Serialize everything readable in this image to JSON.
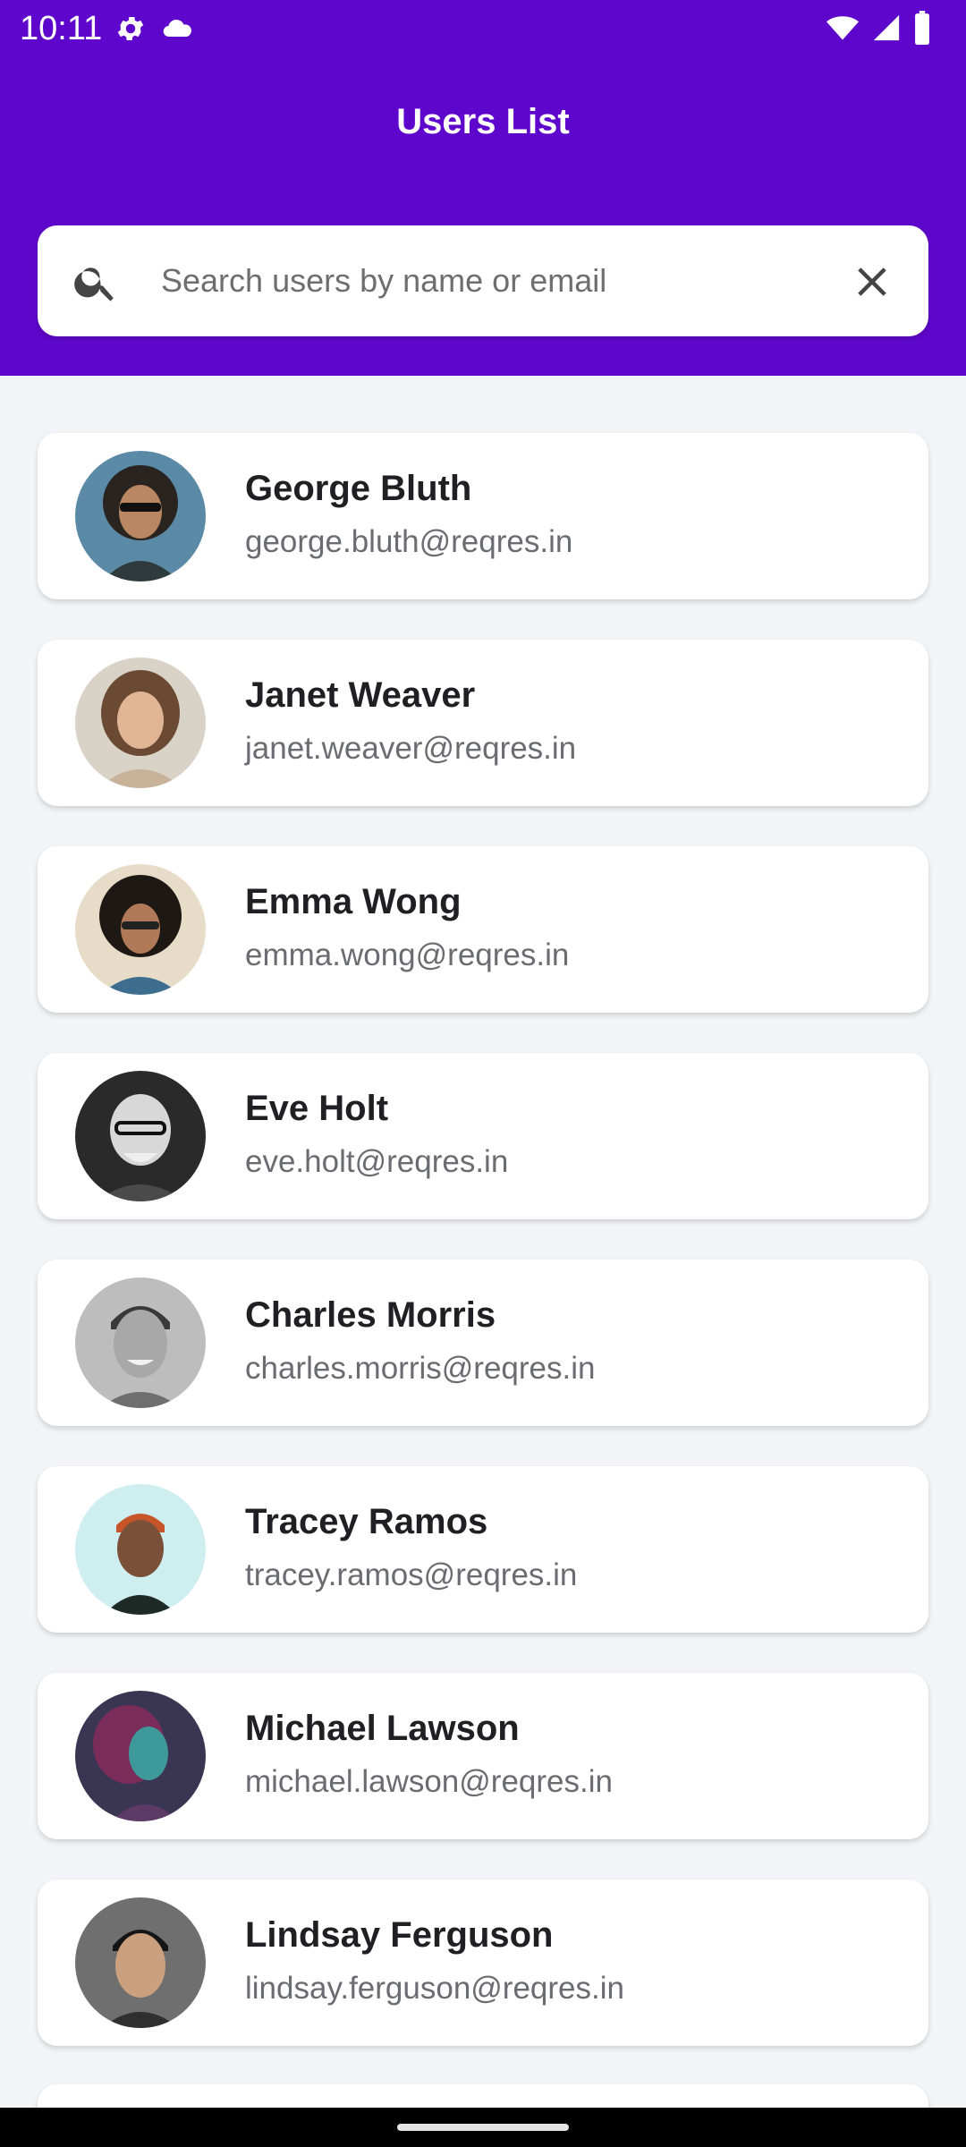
{
  "status_bar": {
    "time": "10:11",
    "left_icons": [
      "settings-icon",
      "cloud-icon"
    ],
    "right_icons": [
      "wifi-icon",
      "signal-icon",
      "battery-icon"
    ]
  },
  "app_bar": {
    "title": "Users List"
  },
  "search": {
    "placeholder": "Search users by name or email",
    "value": "",
    "leading_icon": "search-icon",
    "trailing_icon": "close-icon"
  },
  "colors": {
    "primary": "#5f06cc",
    "background": "#f3f4f8",
    "card": "#ffffff",
    "name_text": "#1f1f24",
    "email_text": "#6b6b72"
  },
  "users": [
    {
      "name": "George Bluth",
      "email": "george.bluth@reqres.in"
    },
    {
      "name": "Janet Weaver",
      "email": "janet.weaver@reqres.in"
    },
    {
      "name": "Emma Wong",
      "email": "emma.wong@reqres.in"
    },
    {
      "name": "Eve Holt",
      "email": "eve.holt@reqres.in"
    },
    {
      "name": "Charles Morris",
      "email": "charles.morris@reqres.in"
    },
    {
      "name": "Tracey Ramos",
      "email": "tracey.ramos@reqres.in"
    },
    {
      "name": "Michael Lawson",
      "email": "michael.lawson@reqres.in"
    },
    {
      "name": "Lindsay Ferguson",
      "email": "lindsay.ferguson@reqres.in"
    }
  ]
}
